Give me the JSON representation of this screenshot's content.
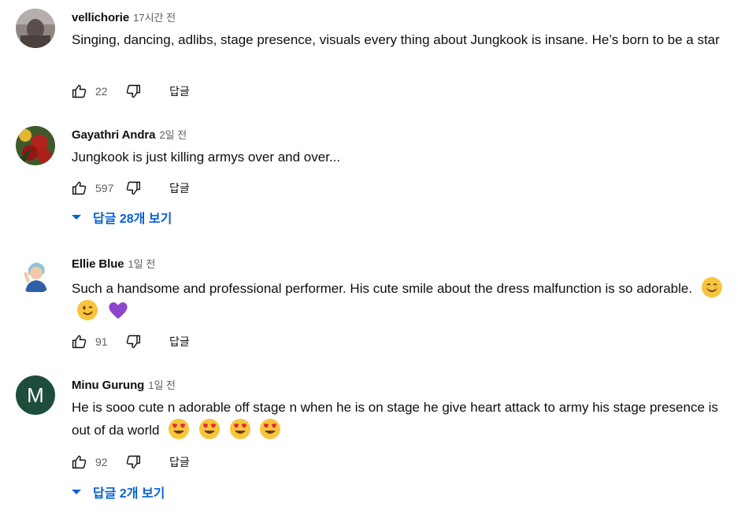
{
  "comments": [
    {
      "author": "vellichorie",
      "time": "17시간 전",
      "text": "Singing, dancing, adlibs, stage presence, visuals every thing about Jungkook is insane. He’s born to be a star",
      "likes": "22",
      "reply_label": "답글",
      "avatar": {
        "type": "photo",
        "color": "#6b5d5a"
      }
    },
    {
      "author": "Gayathri Andra",
      "time": "2일 전",
      "text": "Jungkook is just killing armys over and over...",
      "likes": "597",
      "reply_label": "답글",
      "avatar": {
        "type": "photo",
        "color": "#8a1f1f"
      },
      "replies_toggle": "답글 28개 보기"
    },
    {
      "author": "Ellie Blue",
      "time": "1일 전",
      "text": "Such a handsome and professional performer. His cute smile about the dress malfunction is so adorable.",
      "emojis": [
        "smiling-face-emoji",
        "winking-face-emoji",
        "purple-heart-emoji"
      ],
      "likes": "91",
      "reply_label": "답글",
      "avatar": {
        "type": "cartoon",
        "color": "#9fc7d8"
      }
    },
    {
      "author": "Minu Gurung",
      "time": "1일 전",
      "text": "He is sooo cute n adorable off stage n when he is on stage he give heart attack to army his stage presence is out of da world",
      "emojis": [
        "heart-eyes-emoji",
        "heart-eyes-emoji",
        "heart-eyes-emoji",
        "heart-eyes-emoji"
      ],
      "likes": "92",
      "reply_label": "답글",
      "avatar": {
        "type": "letter",
        "letter": "M",
        "color": "#1e4d3b"
      },
      "replies_toggle": "답글 2개 보기"
    }
  ],
  "colors": {
    "link": "#065fd4",
    "secondary_text": "#606060",
    "primary_text": "#0f0f0f"
  }
}
